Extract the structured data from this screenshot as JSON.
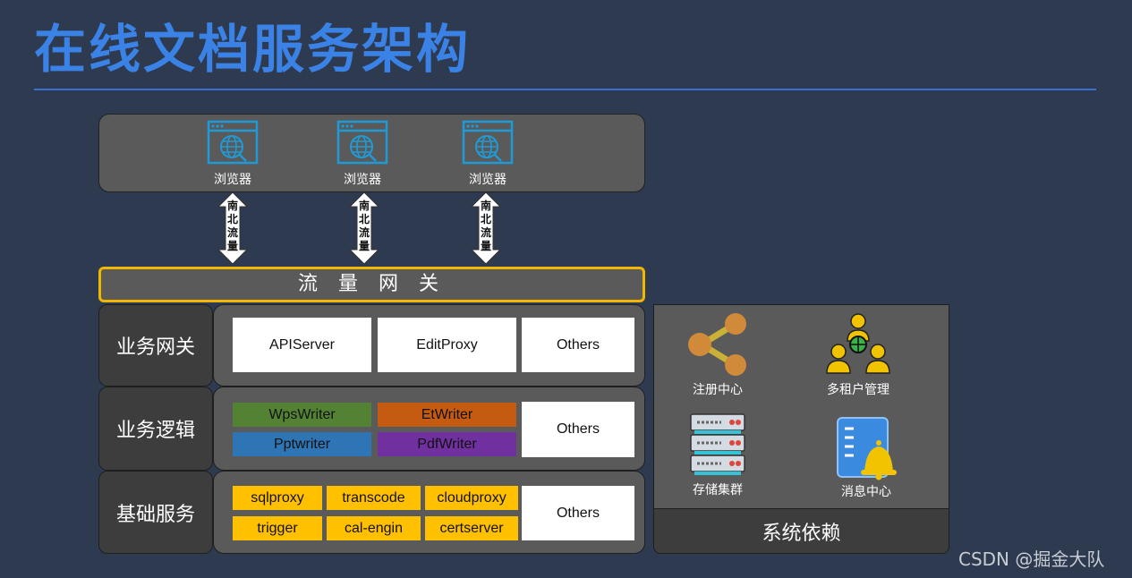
{
  "title": "在线文档服务架构",
  "browsers": [
    {
      "label": "浏览器",
      "icon": "browser-globe-icon"
    },
    {
      "label": "浏览器",
      "icon": "browser-globe-icon"
    },
    {
      "label": "浏览器",
      "icon": "browser-globe-icon"
    }
  ],
  "arrow_text": [
    "南",
    "北",
    "流",
    "量"
  ],
  "traffic_gateway": "流 量 网 关",
  "rows": {
    "business_gateway": {
      "label": "业务网关",
      "items": [
        "APIServer",
        "EditProxy",
        "Others"
      ]
    },
    "business_logic": {
      "label": "业务逻辑",
      "items": [
        "WpsWriter",
        "EtWriter",
        "Pptwriter",
        "PdfWriter",
        "Others"
      ]
    },
    "base_services": {
      "label": "基础服务",
      "items": [
        "sqlproxy",
        "transcode",
        "cloudproxy",
        "trigger",
        "cal-engin",
        "certserver",
        "Others"
      ]
    }
  },
  "dependencies": {
    "label": "系统依赖",
    "items": [
      {
        "label": "注册中心",
        "icon": "share-icon"
      },
      {
        "label": "多租户管理",
        "icon": "multi-tenant-icon"
      },
      {
        "label": "存储集群",
        "icon": "server-stack-icon"
      },
      {
        "label": "消息中心",
        "icon": "notification-bell-icon"
      }
    ]
  },
  "watermark": "CSDN @掘金大队",
  "colors": {
    "background": "#2d3a4f",
    "title": "#3b82e6",
    "gateway_border": "#f2b600",
    "wpswriter": "#548235",
    "etwriter": "#c55a11",
    "pptwriter": "#2e75b6",
    "pdfwriter": "#7030a0",
    "base_service": "#ffc000"
  }
}
